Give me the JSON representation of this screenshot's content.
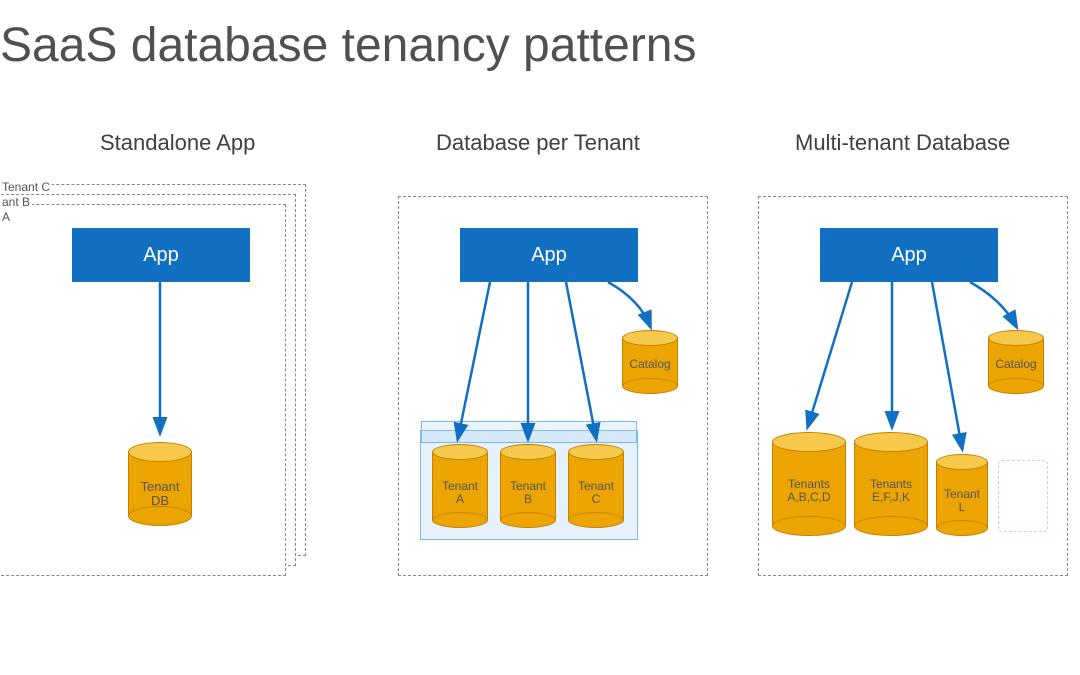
{
  "title": "SaaS database tenancy patterns",
  "sections": {
    "standalone": {
      "label": "Standalone App",
      "stack_tags": [
        "Tenant C",
        "ant B",
        "A"
      ],
      "app_label": "App",
      "db_label": "Tenant\nDB"
    },
    "per_tenant": {
      "label": "Database per Tenant",
      "app_label": "App",
      "catalog_label": "Catalog",
      "dbs": [
        "Tenant\nA",
        "Tenant\nB",
        "Tenant\nC"
      ]
    },
    "multi_tenant": {
      "label": "Multi-tenant Database",
      "app_label": "App",
      "catalog_label": "Catalog",
      "dbs": [
        "Tenants\nA,B,C,D",
        "Tenants\nE,F,J,K",
        "Tenant\nL"
      ]
    }
  },
  "colors": {
    "app": "#1170c1",
    "db_body": "#eca400",
    "db_top": "#f6c84c",
    "arrow": "#1170c1"
  }
}
